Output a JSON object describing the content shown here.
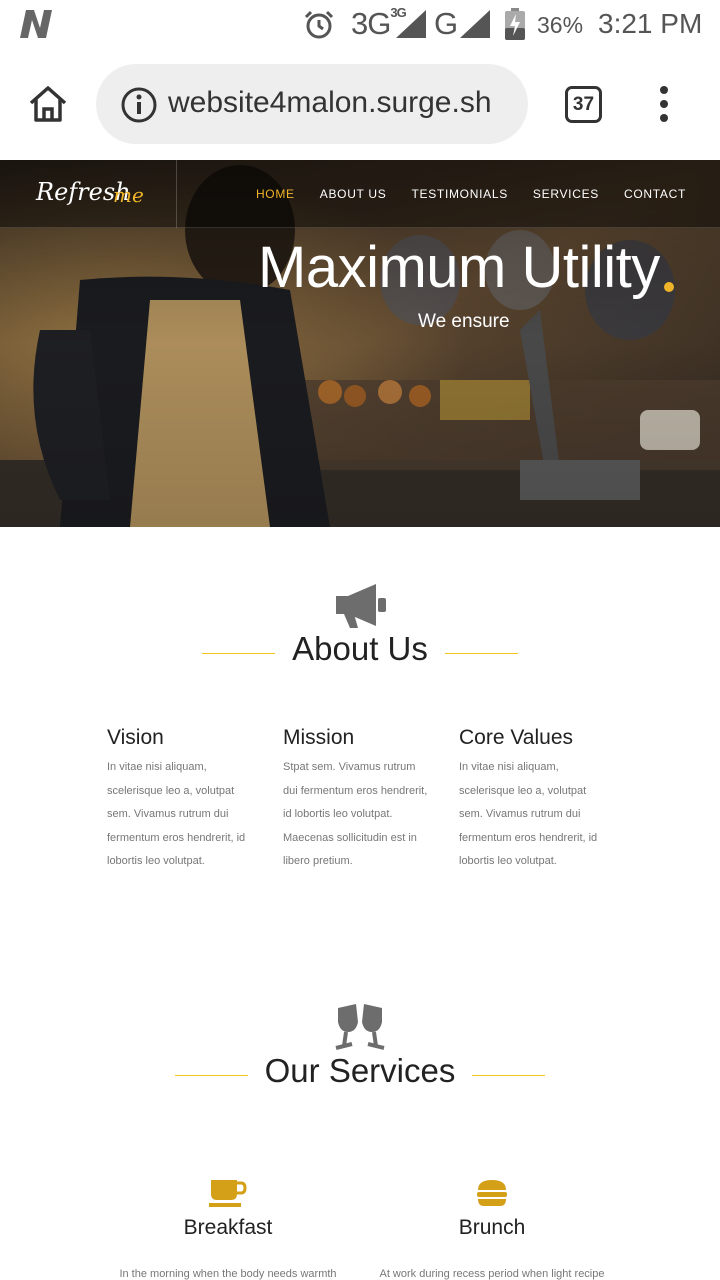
{
  "status_bar": {
    "network_1": "3G",
    "network_1_sup": "3G",
    "network_2": "G",
    "battery_percent": "36%",
    "time": "3:21 PM"
  },
  "browser": {
    "url": "website4malon.surge.sh",
    "tab_count": "37"
  },
  "site": {
    "brand_main": "Refresh",
    "brand_accent": "me",
    "nav": [
      "HOME",
      "ABOUT US",
      "TESTIMONIALS",
      "SERVICES",
      "CONTACT"
    ],
    "active_nav": "HOME",
    "hero_title": "Maximum Utility",
    "hero_subtitle": "We ensure",
    "accent_color": "#f0b429"
  },
  "about": {
    "heading": "About Us",
    "icon": "megaphone-icon",
    "columns": [
      {
        "title": "Vision",
        "lines": [
          "In vitae nisi aliquam,",
          "scelerisque leo a, volutpat",
          "sem. Vivamus rutrum dui",
          "fermentum eros hendrerit, id",
          "lobortis leo volutpat."
        ]
      },
      {
        "title": "Mission",
        "lines": [
          "Stpat sem. Vivamus rutrum",
          "dui fermentum eros hendrerit,",
          "id lobortis leo volutpat.",
          "Maecenas sollicitudin est in",
          "libero pretium."
        ]
      },
      {
        "title": "Core Values",
        "lines": [
          "In vitae nisi aliquam,",
          "scelerisque leo a, volutpat",
          "sem. Vivamus rutrum dui",
          "fermentum eros hendrerit, id",
          "lobortis leo volutpat."
        ]
      }
    ]
  },
  "services": {
    "heading": "Our Services",
    "icon": "glasses-cheers-icon",
    "items": [
      {
        "title": "Breakfast",
        "icon": "coffee-icon",
        "text": "In the morning when the body needs warmth"
      },
      {
        "title": "Brunch",
        "icon": "burger-icon",
        "text": "At work during recess period when light recipe"
      }
    ]
  }
}
